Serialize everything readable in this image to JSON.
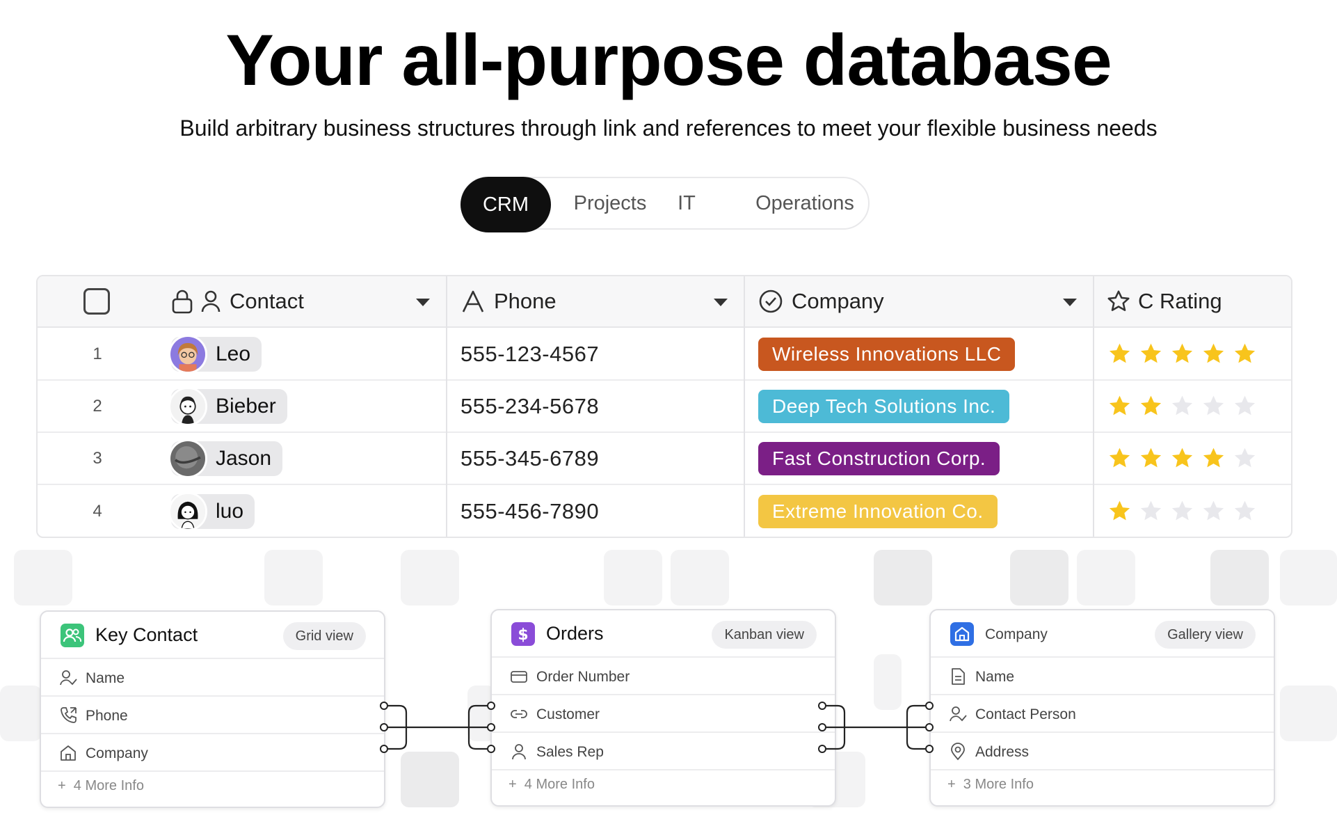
{
  "hero": {
    "title": "Your all-purpose database",
    "subtitle": "Build arbitrary business structures through link and references to meet your flexible business needs"
  },
  "tabs": [
    {
      "label": "CRM",
      "active": true
    },
    {
      "label": "Projects",
      "active": false
    },
    {
      "label": "IT",
      "active": false
    },
    {
      "label": "Operations",
      "active": false
    }
  ],
  "table": {
    "columns": [
      {
        "label": "Contact",
        "icon": "person-icon"
      },
      {
        "label": "Phone",
        "icon": "text-a-icon"
      },
      {
        "label": "Company",
        "icon": "check-circle-icon"
      },
      {
        "label": "C Rating",
        "icon": "star-outline-icon"
      }
    ],
    "rows": [
      {
        "num": "1",
        "contact": "Leo",
        "phone": "555-123-4567",
        "company": "Wireless Innovations LLC",
        "company_color": "#c8571f",
        "rating": 5
      },
      {
        "num": "2",
        "contact": "Bieber",
        "phone": "555-234-5678",
        "company": "Deep Tech Solutions Inc.",
        "company_color": "#4dbad6",
        "rating": 2
      },
      {
        "num": "3",
        "contact": "Jason",
        "phone": "555-345-6789",
        "company": "Fast Construction Corp.",
        "company_color": "#7b1f86",
        "rating": 4
      },
      {
        "num": "4",
        "contact": "luo",
        "phone": "555-456-7890",
        "company": "Extreme Innovation Co.",
        "company_color": "#f3c643",
        "rating": 1
      }
    ],
    "star_color": "#f8c41c",
    "star_empty_color": "#e8e8ec"
  },
  "cards": [
    {
      "title": "Key Contact",
      "view": "Grid view",
      "icon_color": "#3cc47a",
      "fields": [
        {
          "label": "Name",
          "icon": "person-check-icon"
        },
        {
          "label": "Phone",
          "icon": "phone-icon"
        },
        {
          "label": "Company",
          "icon": "home-icon"
        }
      ],
      "more": "4 More Info"
    },
    {
      "title": "Orders",
      "view": "Kanban view",
      "icon_color": "#8a4cd8",
      "fields": [
        {
          "label": "Order Number",
          "icon": "card-icon"
        },
        {
          "label": "Customer",
          "icon": "link-icon"
        },
        {
          "label": "Sales Rep",
          "icon": "person-icon"
        }
      ],
      "more": "4 More Info"
    },
    {
      "title": "Company",
      "view": "Gallery view",
      "icon_color": "#2f6fe4",
      "fields": [
        {
          "label": "Name",
          "icon": "document-icon"
        },
        {
          "label": "Contact Person",
          "icon": "person-check-icon"
        },
        {
          "label": "Address",
          "icon": "location-pin-icon"
        }
      ],
      "more": "3 More Info"
    }
  ]
}
